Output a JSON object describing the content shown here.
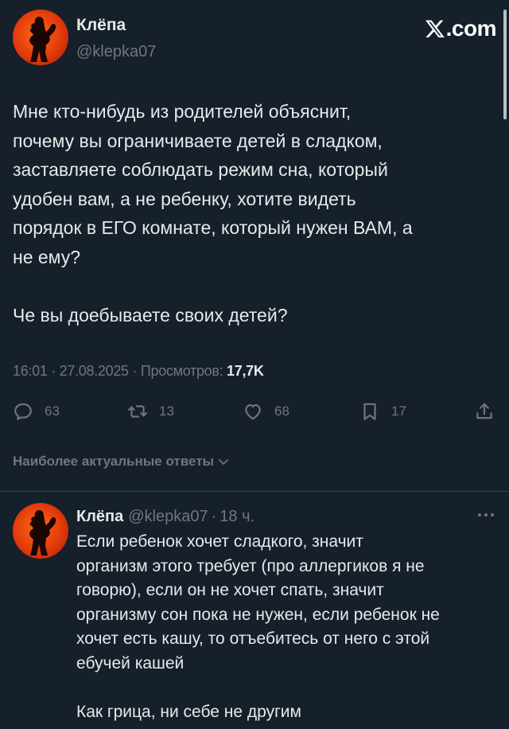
{
  "tweet": {
    "author_name": "Клёпа",
    "author_handle": "@klepka07",
    "site_logo": "X.com",
    "text": "Мне кто-нибудь из родителей объяснит,\nпочему вы ограничиваете детей в сладком,\nзаставляете соблюдать режим сна, который\nудобен вам, а не ребенку, хотите видеть\nпорядок в ЕГО комнате, который нужен ВАМ, а\nне ему?\n\nЧе вы доебываете своих детей?",
    "time": "16:01",
    "date": "27.08.2025",
    "views_label": "Просмотров:",
    "views_count": "17,7K",
    "separator": "·",
    "stats": {
      "replies": "63",
      "retweets": "13",
      "likes": "68",
      "bookmarks": "17"
    }
  },
  "sort": {
    "label": "Наиболее актуальные ответы"
  },
  "reply": {
    "author_name": "Клёпа",
    "author_handle": "@klepka07",
    "separator": "·",
    "time_ago": "18 ч.",
    "text": "Если ребенок хочет сладкого, значит\nорганизм этого требует (про аллергиков я не\nговорю), если он не хочет спать, значит\nорганизму сон пока не нужен, если ребенок не\nхочет есть кашу, то отъебитесь от него с этой\nебучей кашей\n\nКак грица, ни себе не другим"
  },
  "colors": {
    "background": "#15202b",
    "text": "#e7e9ea",
    "muted": "#71767b",
    "divider": "#38444d",
    "avatar": "#e23a0a"
  },
  "icons": [
    "avatar",
    "x-logo-icon",
    "reply-icon",
    "retweet-icon",
    "like-icon",
    "bookmark-icon",
    "share-icon",
    "chevron-down-icon",
    "more-icon"
  ]
}
